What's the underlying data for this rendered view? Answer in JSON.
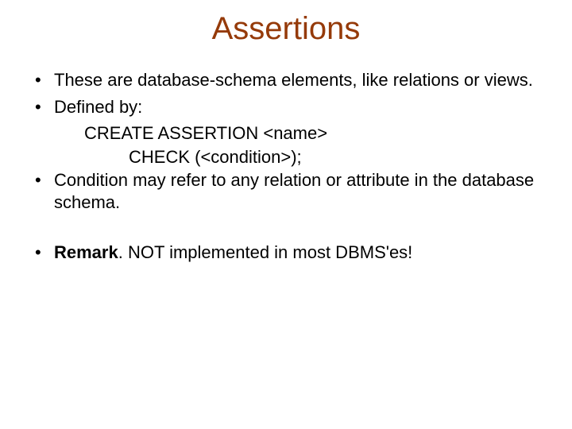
{
  "title": "Assertions",
  "bullets": {
    "b1": "These are database-schema elements, like relations or views.",
    "b2": "Defined by:",
    "b2_line1": "CREATE ASSERTION <name>",
    "b2_line2": "CHECK (<condition>);",
    "b3": "Condition may refer to any relation or attribute in the database schema.",
    "b4_lead": "Remark",
    "b4_rest": ". NOT implemented in most DBMS'es!"
  }
}
